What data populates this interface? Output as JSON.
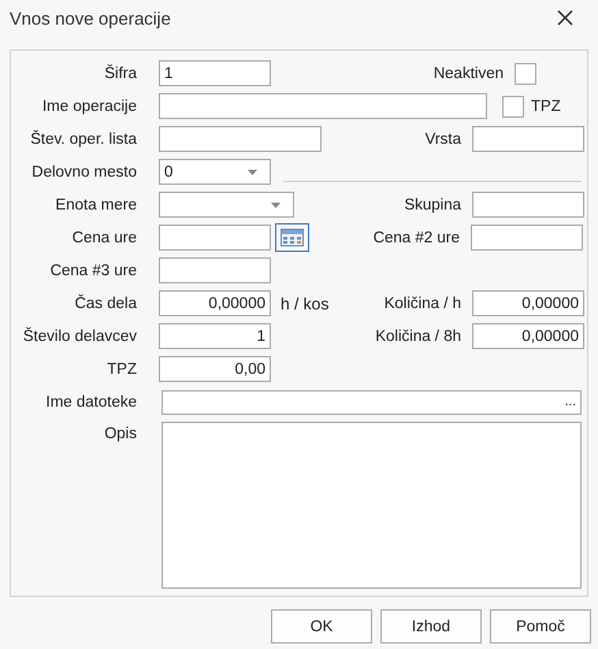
{
  "window": {
    "title": "Vnos nove operacije"
  },
  "sifra": {
    "label": "Šifra",
    "value": "1"
  },
  "neaktiven": {
    "label": "Neaktiven",
    "checked": false
  },
  "ime_operacije": {
    "label": "Ime operacije"
  },
  "tpz_check": {
    "label": "TPZ",
    "checked": false
  },
  "stev_oper_lista": {
    "label": "Štev. oper. lista"
  },
  "vrsta": {
    "label": "Vrsta"
  },
  "delovno_mesto": {
    "label": "Delovno mesto",
    "value": "0"
  },
  "enota_mere": {
    "label": "Enota mere"
  },
  "skupina": {
    "label": "Skupina"
  },
  "cena_ure": {
    "label": "Cena ure"
  },
  "cena_2_ure": {
    "label": "Cena #2 ure"
  },
  "cena_3_ure": {
    "label": "Cena #3 ure"
  },
  "cas_dela": {
    "label": "Čas dela",
    "value": "0,00000",
    "unit": "h / kos"
  },
  "kolicina_h": {
    "label": "Količina / h",
    "value": "0,00000"
  },
  "stevilo_delavcev": {
    "label": "Število delavcev",
    "value": "1"
  },
  "kolicina_8h": {
    "label": "Količina / 8h",
    "value": "0,00000"
  },
  "tpz": {
    "label": "TPZ",
    "value": "0,00"
  },
  "ime_datoteke": {
    "label": "Ime datoteke",
    "button": "..."
  },
  "opis": {
    "label": "Opis"
  },
  "buttons": [
    "OK",
    "Izhod",
    "Pomoč"
  ]
}
